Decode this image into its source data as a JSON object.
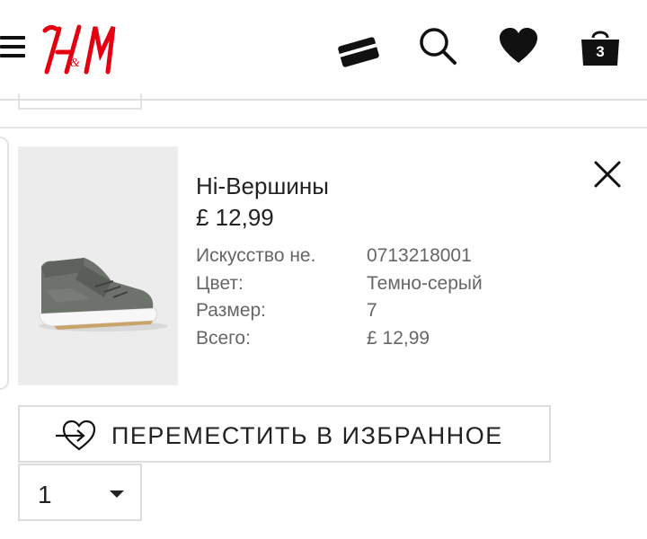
{
  "header": {
    "brand": "H&M",
    "brand_color": "#e50010",
    "icons": [
      "menu-icon",
      "credit-card-icon",
      "search-icon",
      "heart-icon",
      "shopping-bag-icon"
    ],
    "bag_count": "3"
  },
  "cart_item": {
    "name": "Hi-Вершины",
    "price": "£ 12,99",
    "details": [
      {
        "label": "Искусство не.",
        "value": "0713218001"
      },
      {
        "label": "Цвет:",
        "value": "Темно-серый"
      },
      {
        "label": "Размер:",
        "value": "7"
      },
      {
        "label": "Всего:",
        "value": "£ 12,99"
      }
    ],
    "image": "dark grey high-top sneaker",
    "remove_icon": "close-icon"
  },
  "actions": {
    "move_to_favourites": "ПЕРЕМЕСТИТЬ В ИЗБРАННОЕ",
    "move_icon": "heart-arrow-icon"
  },
  "quantity": {
    "value": "1",
    "icon": "chevron-down-icon"
  }
}
